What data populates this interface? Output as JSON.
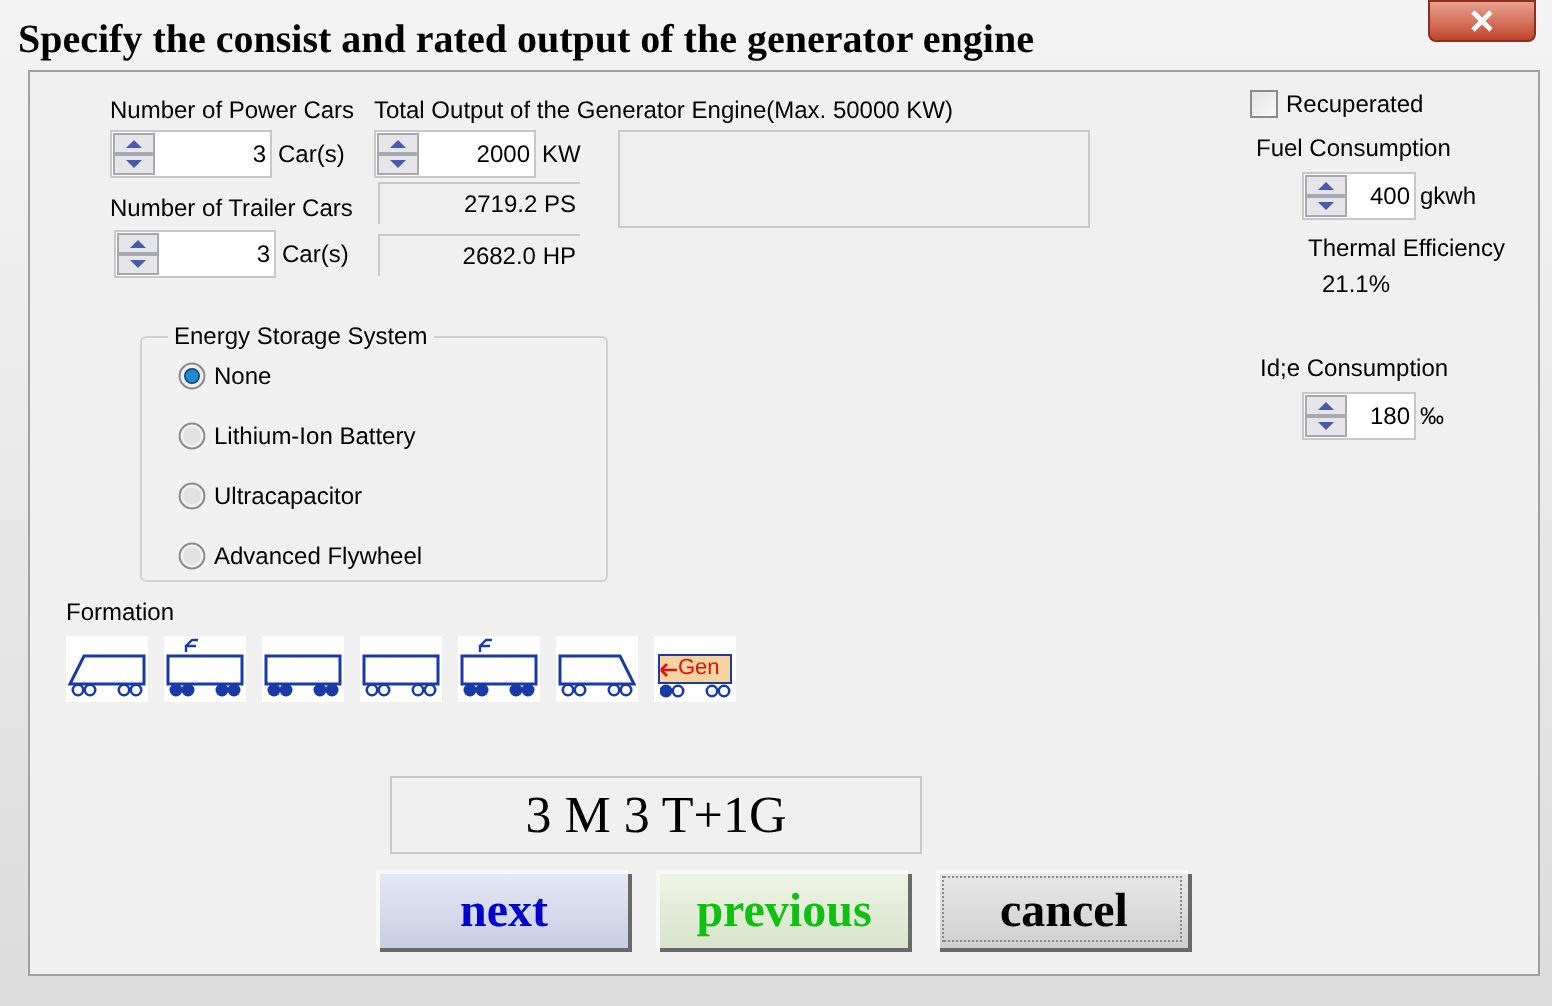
{
  "window": {
    "title": "Specify the consist and rated output of the generator engine"
  },
  "power_cars": {
    "label": "Number of Power Cars",
    "value": "3",
    "unit": "Car(s)"
  },
  "trailer_cars": {
    "label": "Number of Trailer Cars",
    "value": "3",
    "unit": "Car(s)"
  },
  "output": {
    "label": "Total Output of the Generator Engine(Max. 50000 KW)",
    "value": "2000",
    "unit": "KW",
    "ps": "2719.2 PS",
    "hp": "2682.0 HP"
  },
  "recuperated": {
    "label": "Recuperated",
    "checked": false
  },
  "fuel": {
    "label": "Fuel Consumption",
    "value": "400",
    "unit": "gkwh"
  },
  "thermal": {
    "label": "Thermal Efficiency",
    "value": "21.1%"
  },
  "idle": {
    "label": "Id;e Consumption",
    "value": "180",
    "unit": "‰"
  },
  "energy_storage": {
    "title": "Energy Storage System",
    "options": [
      {
        "label": "None",
        "selected": true
      },
      {
        "label": "Lithium-Ion Battery",
        "selected": false
      },
      {
        "label": "Ultracapacitor",
        "selected": false
      },
      {
        "label": "Advanced Flywheel",
        "selected": false
      }
    ]
  },
  "formation": {
    "label": "Formation",
    "cars": [
      {
        "kind": "cab_left",
        "powered": false,
        "pantograph": false
      },
      {
        "kind": "box",
        "powered": true,
        "pantograph": true
      },
      {
        "kind": "box",
        "powered": true,
        "pantograph": false
      },
      {
        "kind": "box",
        "powered": false,
        "pantograph": false
      },
      {
        "kind": "box",
        "powered": true,
        "pantograph": true
      },
      {
        "kind": "cab_right",
        "powered": false,
        "pantograph": false
      },
      {
        "kind": "generator",
        "powered": false,
        "label": "Gen"
      }
    ]
  },
  "summary": "3 M 3 T+1G",
  "buttons": [
    {
      "kind": "next",
      "label": "next"
    },
    {
      "kind": "previous",
      "label": "previous"
    },
    {
      "kind": "cancel",
      "label": "cancel"
    }
  ]
}
